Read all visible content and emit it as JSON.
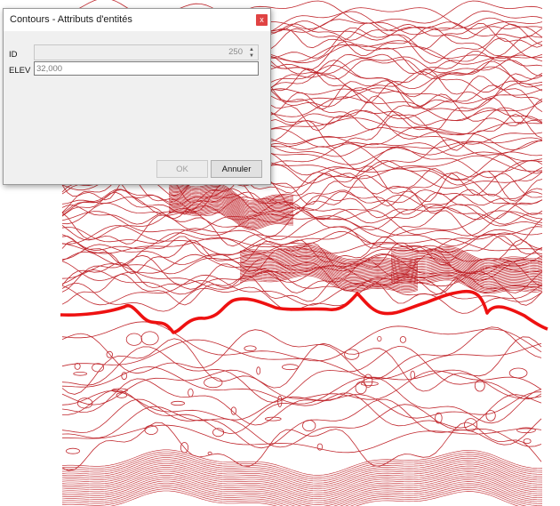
{
  "dialog": {
    "title": "Contours - Attributs d'entités",
    "close_glyph": "x",
    "fields": {
      "id_label": "ID",
      "id_value": "250",
      "elev_label": "ELEV",
      "elev_placeholder": "32,000"
    },
    "buttons": {
      "ok_label": "OK",
      "cancel_label": "Annuler"
    }
  },
  "map": {
    "contour_color": "#c0272d",
    "highlight_color": "#ee1111"
  }
}
